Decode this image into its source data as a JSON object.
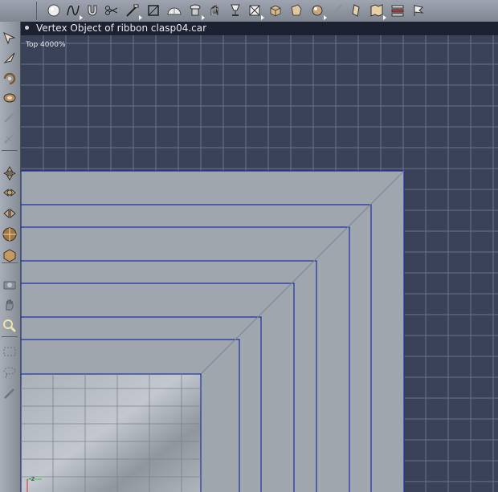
{
  "window": {
    "title": "Vertex Object of ribbon clasp04.car",
    "view_label": "Top 4000%"
  },
  "toolbar": {
    "items": [
      {
        "icon": "sphere-icon"
      },
      {
        "icon": "spline-icon"
      },
      {
        "icon": "magnet-icon"
      },
      {
        "icon": "scissors-icon"
      },
      {
        "icon": "knife-icon"
      },
      {
        "icon": "square-icon"
      },
      {
        "icon": "dome-icon"
      },
      {
        "icon": "lathe-icon"
      },
      {
        "icon": "hand-deform-icon"
      },
      {
        "icon": "goblet-icon"
      },
      {
        "icon": "box-x-icon"
      },
      {
        "icon": "cube-icon"
      },
      {
        "icon": "bag-icon"
      },
      {
        "icon": "ball-icon"
      },
      {
        "icon": "brush-icon"
      },
      {
        "icon": "figure-icon"
      },
      {
        "icon": "map-icon"
      },
      {
        "icon": "stack-icon"
      },
      {
        "icon": "flag-icon"
      }
    ]
  },
  "left_tools": {
    "items": [
      {
        "icon": "pointer-arrow-icon"
      },
      {
        "icon": "direct-select-icon"
      },
      {
        "icon": "rotate-icon"
      },
      {
        "icon": "twist-icon"
      },
      {
        "icon": "pen-disabled-icon"
      },
      {
        "icon": "pen-alt-disabled-icon"
      },
      {
        "icon": "move-icon"
      },
      {
        "icon": "move-xy-icon"
      },
      {
        "icon": "scale-icon"
      },
      {
        "icon": "globe-rotate-icon"
      },
      {
        "icon": "cube-transform-icon"
      },
      {
        "icon": "camera-icon"
      },
      {
        "icon": "hand-pan-icon"
      },
      {
        "icon": "zoom-magnifier-icon"
      },
      {
        "icon": "marquee-icon"
      },
      {
        "icon": "lasso-icon"
      },
      {
        "icon": "eyedropper-icon"
      }
    ]
  },
  "axis_indicator": {
    "label": "-z"
  },
  "colors": {
    "background": "#3a4258",
    "grid_line": "#6c7388",
    "surface": "#9ea6ae",
    "outline": "#1f2fa8",
    "title_bar": "#1d2232"
  }
}
